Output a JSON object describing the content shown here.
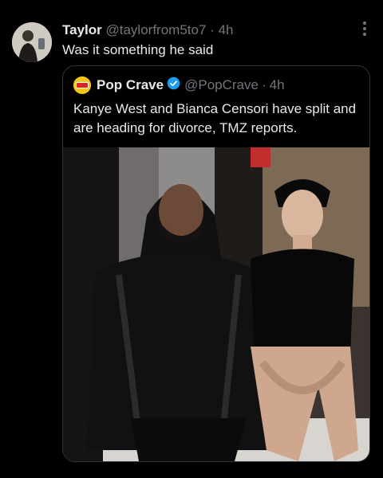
{
  "tweet": {
    "display_name": "Taylor",
    "handle": "@taylorfrom5to7",
    "separator": "·",
    "time": "4h",
    "text": "Was it something he said",
    "avatar_icon": "profile-photo",
    "more_icon": "more-vertical-icon"
  },
  "quote": {
    "display_name": "Pop Crave",
    "handle": "@PopCrave",
    "separator": "·",
    "time": "4h",
    "text": "Kanye West and Bianca Censori have split and are heading for divorce, TMZ reports.",
    "logo_text": "POP CRAVE",
    "verified_color": "#1d9bf0"
  },
  "colors": {
    "background": "#000000",
    "text_primary": "#e7e9ea",
    "text_secondary": "#71767b",
    "border": "#2f3336"
  }
}
